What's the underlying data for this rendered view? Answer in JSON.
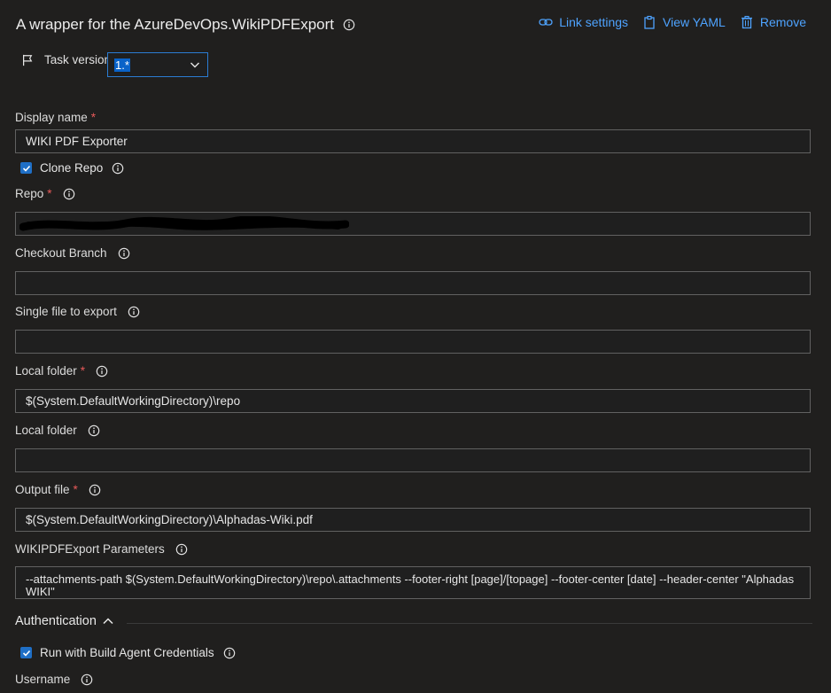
{
  "header": {
    "title": "A wrapper for the AzureDevOps.WikiPDFExport",
    "actions": [
      {
        "label": "Link settings",
        "icon": "link-icon"
      },
      {
        "label": "View YAML",
        "icon": "clipboard-icon"
      },
      {
        "label": "Remove",
        "icon": "trash-icon"
      }
    ]
  },
  "task_version": {
    "label": "Task version",
    "value": "1.*"
  },
  "fields": {
    "display_name": {
      "label": "Display name",
      "required": "*",
      "value": "WIKI PDF Exporter"
    },
    "clone_repo": {
      "label": "Clone Repo",
      "checked": true
    },
    "repo": {
      "label": "Repo",
      "required": "*",
      "value": ""
    },
    "checkout_branch": {
      "label": "Checkout Branch",
      "value": ""
    },
    "single_file": {
      "label": "Single file to export",
      "value": ""
    },
    "local_folder_req": {
      "label": "Local folder",
      "required": "*",
      "value": "$(System.DefaultWorkingDirectory)\\repo"
    },
    "local_folder": {
      "label": "Local folder",
      "value": ""
    },
    "output_file": {
      "label": "Output file",
      "required": "*",
      "value": "$(System.DefaultWorkingDirectory)\\Alphadas-Wiki.pdf"
    },
    "params": {
      "label": "WIKIPDFExport Parameters",
      "value": "--attachments-path $(System.DefaultWorkingDirectory)\\repo\\.attachments --footer-right [page]/[topage] --footer-center [date] --header-center \"Alphadas WIKI\""
    }
  },
  "authentication": {
    "label": "Authentication",
    "run_with_agent": {
      "label": "Run with Build Agent Credentials",
      "checked": true
    },
    "username": {
      "label": "Username"
    }
  },
  "colors": {
    "accent": "#4ea3ff",
    "required": "#e85a5a",
    "checkbox": "#1f6fc6"
  }
}
